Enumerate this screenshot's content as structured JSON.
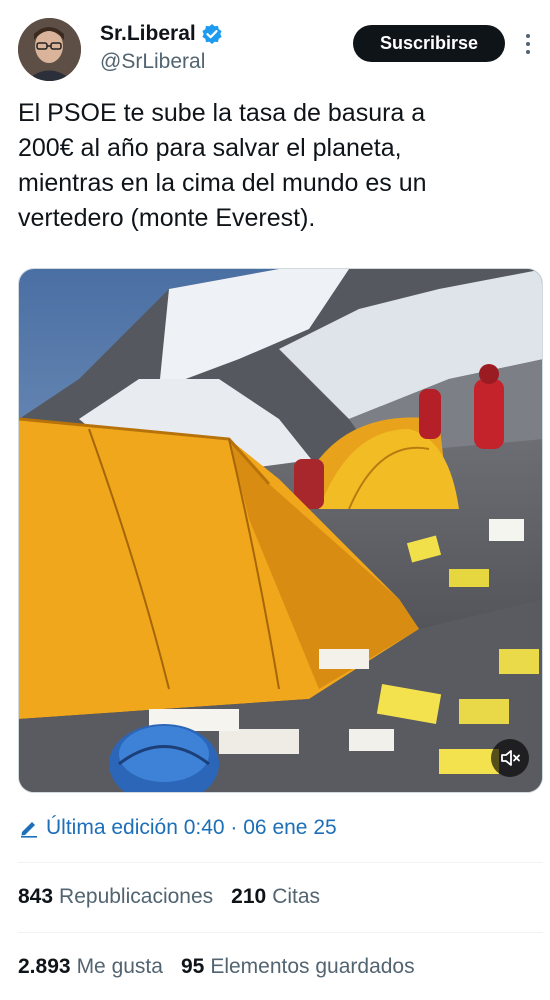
{
  "author": {
    "display_name": "Sr.Liberal",
    "handle": "@SrLiberal",
    "verified_icon": "verified-badge-icon",
    "verified_color": "#1d9bf0"
  },
  "actions": {
    "subscribe_label": "Suscribirse",
    "more_icon": "more-vertical-icon"
  },
  "tweet": {
    "text": "El PSOE te sube la tasa de basura a\n200€ al año para salvar el planeta,\nmientras en la cima del mundo es un\nvertedero (monte Everest).",
    "media_type": "video",
    "mute_icon": "speaker-muted-icon"
  },
  "edit_info": {
    "icon": "pencil-icon",
    "text": "Última edición 0:40 · 06 ene 25",
    "color": "#1d6fb8"
  },
  "stats": {
    "reposts": {
      "count": "843",
      "label": "Republicaciones"
    },
    "quotes": {
      "count": "210",
      "label": "Citas"
    },
    "likes": {
      "count": "2.893",
      "label": "Me gusta"
    },
    "bookmarks": {
      "count": "95",
      "label": "Elementos guardados"
    }
  }
}
